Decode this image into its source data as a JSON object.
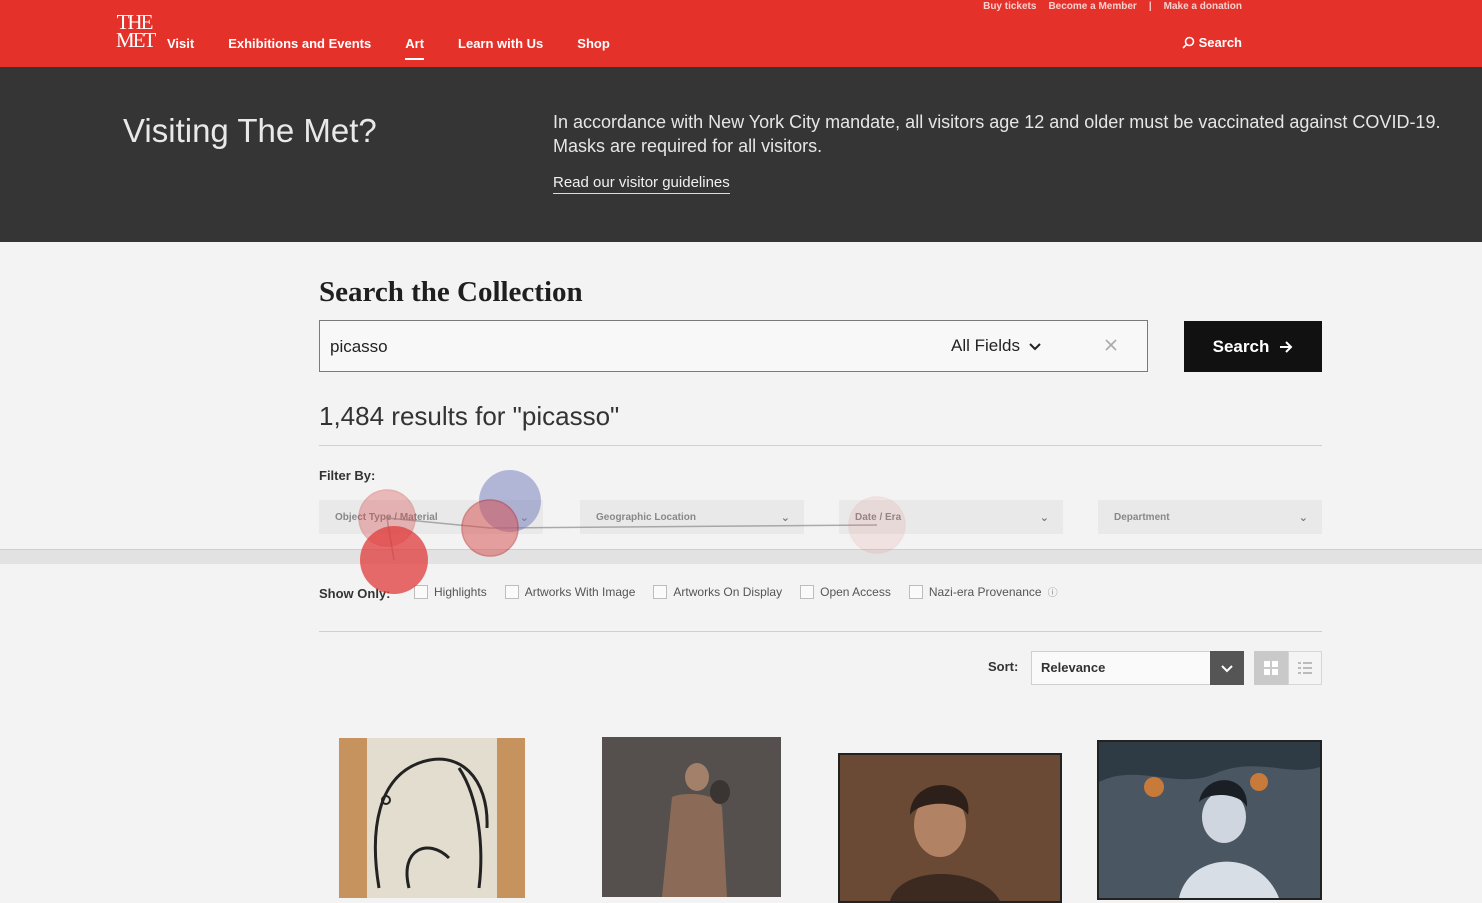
{
  "utility": {
    "buy": "Buy tickets",
    "member": "Become a Member",
    "sep": "|",
    "donate": "Make a donation"
  },
  "logo": {
    "line1": "THE",
    "line2": "MET"
  },
  "nav": {
    "visit": "Visit",
    "exhibitions": "Exhibitions and Events",
    "art": "Art",
    "learn": "Learn with Us",
    "shop": "Shop",
    "search": "Search"
  },
  "banner": {
    "title": "Visiting The Met?",
    "line1": "In accordance with New York City mandate, all visitors age 12 and older must be vaccinated against COVID-19.",
    "line2": "Masks are required for all visitors.",
    "link": "Read our visitor guidelines"
  },
  "search": {
    "title": "Search the Collection",
    "query": "picasso",
    "field": "All Fields",
    "button": "Search"
  },
  "results": {
    "text": "1,484 results for \"picasso\""
  },
  "filters": {
    "label": "Filter By:",
    "object": "Object Type / Material",
    "geo": "Geographic Location",
    "date": "Date / Era",
    "department": "Department"
  },
  "show_only": {
    "label": "Show Only:",
    "options": [
      "Highlights",
      "Artworks With Image",
      "Artworks On Display",
      "Open Access",
      "Nazi-era Provenance"
    ]
  },
  "sort": {
    "label": "Sort:",
    "value": "Relevance"
  },
  "colors": {
    "brand_red": "#e4322b",
    "banner_bg": "#353535",
    "button_bg": "#111111"
  }
}
